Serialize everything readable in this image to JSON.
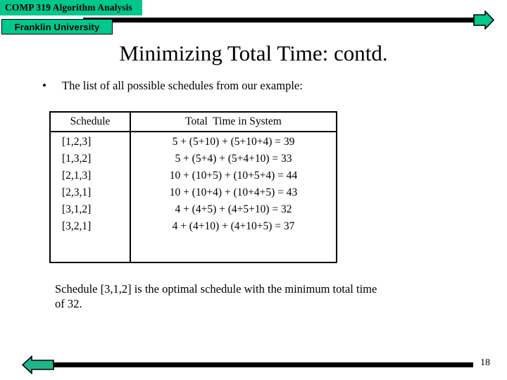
{
  "theme": {
    "brand_green": "#00c78c",
    "rule_black": "#000000",
    "background": "#ffffff"
  },
  "header": {
    "course_banner": "COMP 319 Algorithm Analysis",
    "university_banner": "Franklin University"
  },
  "title": "Minimizing Total Time: contd.",
  "bullet": {
    "marker": "•",
    "text": "The list of all possible schedules from our example:"
  },
  "table": {
    "headers": [
      "Schedule",
      "Total  Time in System"
    ],
    "rows": [
      {
        "schedule": "[1,2,3]",
        "total_time": "5 + (5+10) + (5+10+4) = 39"
      },
      {
        "schedule": "[1,3,2]",
        "total_time": "5 + (5+4) + (5+4+10) = 33"
      },
      {
        "schedule": "[2,1,3]",
        "total_time": "10 + (10+5) + (10+5+4) = 44"
      },
      {
        "schedule": "[2,3,1]",
        "total_time": "10 + (10+4) + (10+4+5) = 43"
      },
      {
        "schedule": "[3,1,2]",
        "total_time": "4 + (4+5) + (4+5+10) = 32"
      },
      {
        "schedule": "[3,2,1]",
        "total_time": "4 + (4+10) + (4+10+5) = 37"
      }
    ]
  },
  "conclusion": {
    "line1": "Schedule [3,1,2] is the optimal schedule with the minimum total time",
    "line2": "of  32."
  },
  "footer": {
    "page_number": "18"
  }
}
